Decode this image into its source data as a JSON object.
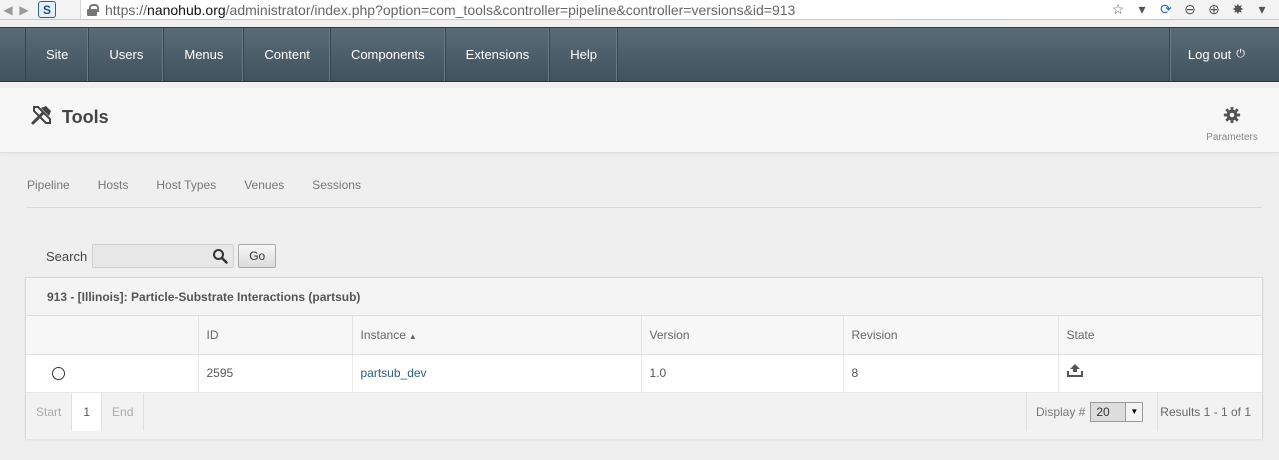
{
  "browser": {
    "url_prefix": "https://",
    "url_domain": "nanohub.org",
    "url_rest": "/administrator/index.php?option=com_tools&controller=pipeline&controller=versions&id=913",
    "site_badge": "S"
  },
  "topnav": {
    "items": [
      "Site",
      "Users",
      "Menus",
      "Content",
      "Components",
      "Extensions",
      "Help"
    ],
    "logout": "Log out"
  },
  "header": {
    "title": "Tools",
    "parameters_label": "Parameters"
  },
  "subnav": {
    "items": [
      "Pipeline",
      "Hosts",
      "Host Types",
      "Venues",
      "Sessions"
    ]
  },
  "search": {
    "label": "Search",
    "value": "",
    "button": "Go"
  },
  "table": {
    "caption": "913 - [Illinois]: Particle-Substrate Interactions (partsub)",
    "columns": [
      "",
      "ID",
      "Instance",
      "Version",
      "Revision",
      "State"
    ],
    "rows": [
      {
        "id": "2595",
        "instance": "partsub_dev",
        "version": "1.0",
        "revision": "8",
        "state_icon": "upload-icon"
      }
    ]
  },
  "pagination": {
    "start": "Start",
    "page": "1",
    "end": "End",
    "display_label": "Display #",
    "display_value": "20",
    "results": "Results 1 - 1 of 1"
  },
  "colors": {
    "nav_bg": "#4c5d6a",
    "link": "#2c5b82"
  }
}
